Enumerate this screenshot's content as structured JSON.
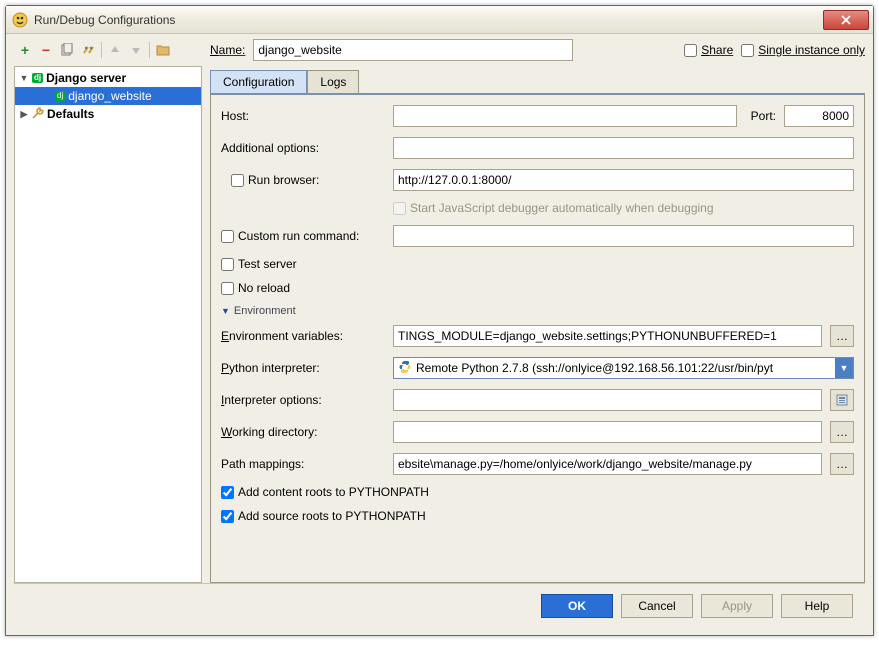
{
  "title": "Run/Debug Configurations",
  "tree": {
    "root": {
      "label": "Django server",
      "badge": "dj"
    },
    "child": {
      "label": "django_website",
      "badge": "dj"
    },
    "defaults": {
      "label": "Defaults"
    }
  },
  "nameRow": {
    "label": "Name:",
    "value": "django_website",
    "shareLabel": "Share",
    "singleInstanceLabel": "Single instance only"
  },
  "tabs": {
    "config": "Configuration",
    "logs": "Logs"
  },
  "fields": {
    "hostLabel": "Host:",
    "hostValue": "",
    "portLabel": "Port:",
    "portValue": "8000",
    "additionalOptionsLabel": "Additional options:",
    "additionalOptionsValue": "",
    "runBrowserLabel": "Run browser:",
    "runBrowserValue": "http://127.0.0.1:8000/",
    "startJsDebuggerLabel": "Start JavaScript debugger automatically when debugging",
    "customRunLabel": "Custom run command:",
    "customRunValue": "",
    "testServerLabel": "Test server",
    "noReloadLabel": "No reload",
    "envSectionLabel": "Environment",
    "envVarsLabel": "Environment variables:",
    "envVarsValue": "TINGS_MODULE=django_website.settings;PYTHONUNBUFFERED=1",
    "pythonInterpLabel": "Python interpreter:",
    "pythonInterpValue": "Remote Python 2.7.8 (ssh://onlyice@192.168.56.101:22/usr/bin/pyt",
    "interpOptionsLabel": "Interpreter options:",
    "interpOptionsValue": "",
    "workingDirLabel": "Working directory:",
    "workingDirValue": "",
    "pathMappingsLabel": "Path mappings:",
    "pathMappingsValue": "ebsite\\manage.py=/home/onlyice/work/django_website/manage.py",
    "addContentRootsLabel": "Add content roots to PYTHONPATH",
    "addSourceRootsLabel": "Add source roots to PYTHONPATH"
  },
  "footer": {
    "ok": "OK",
    "cancel": "Cancel",
    "apply": "Apply",
    "help": "Help"
  }
}
